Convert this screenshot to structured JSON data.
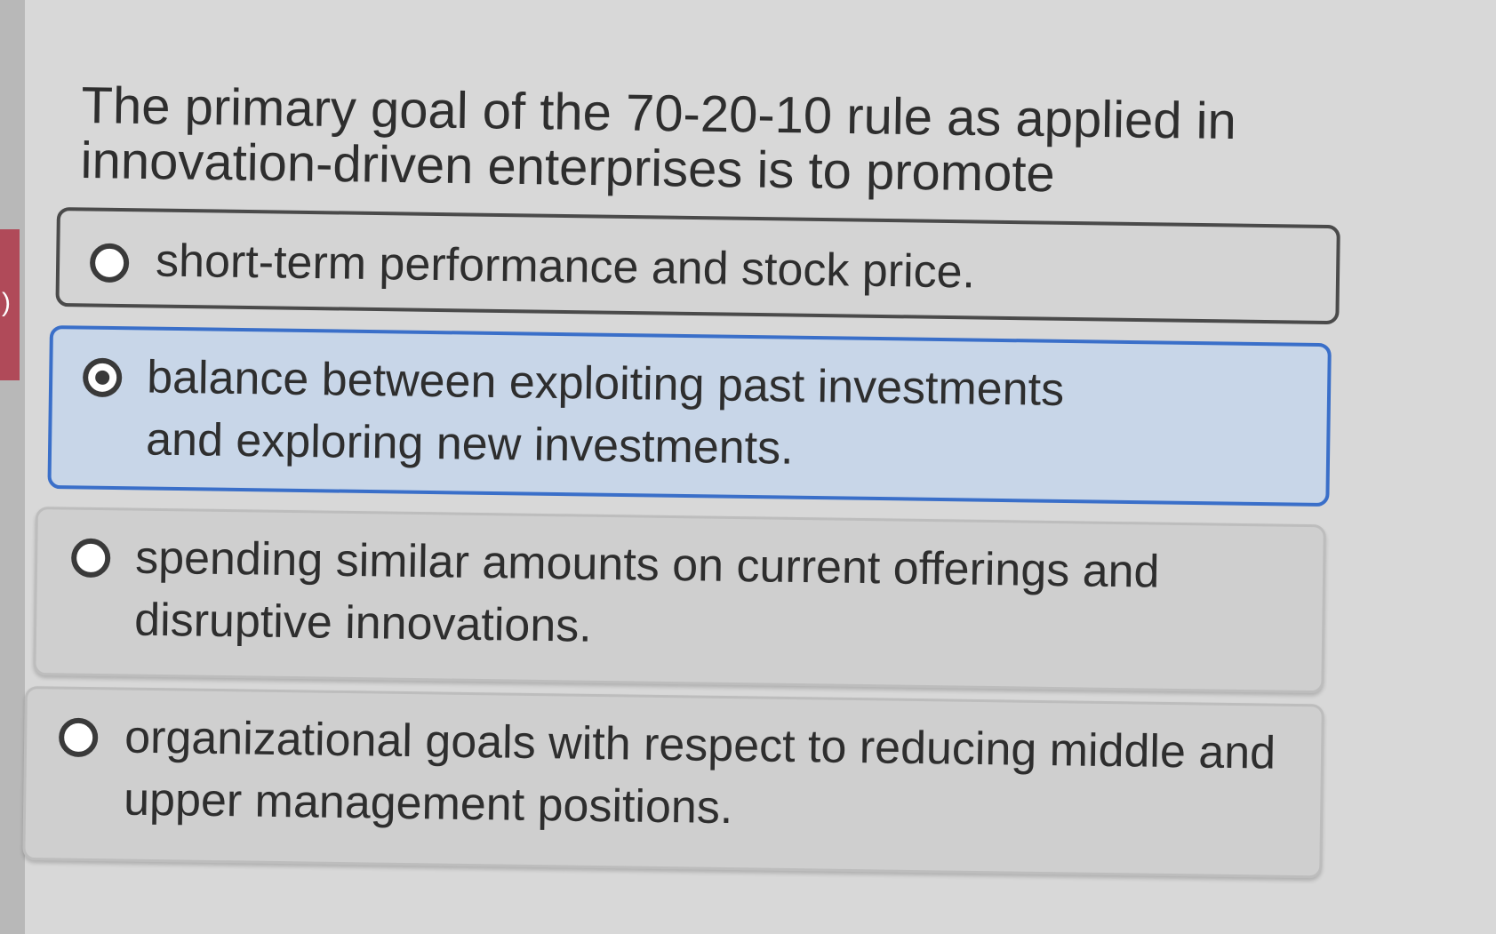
{
  "question": {
    "text": "The primary goal of the 70-20-10 rule as applied in innovation-driven enterprises is to promote"
  },
  "options": [
    {
      "label": "short-term performance and stock price.",
      "selected": false
    },
    {
      "label": "balance between exploiting past investments and exploring new investments.",
      "selected": true
    },
    {
      "label": "spending similar amounts on current offerings and disruptive innovations.",
      "selected": false
    },
    {
      "label": "organizational goals with respect to reducing middle and upper management positions.",
      "selected": false
    }
  ],
  "colors": {
    "selected_border": "#3a6fc9",
    "selected_background": "#c8d6e8",
    "side_accent": "#b04a59"
  }
}
